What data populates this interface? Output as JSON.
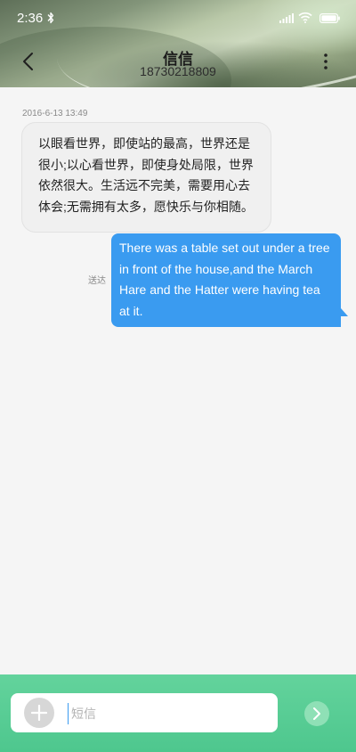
{
  "status_bar": {
    "time": "2:36",
    "icons": [
      "bluetooth-icon",
      "signal-icon",
      "wifi-icon",
      "battery-icon"
    ]
  },
  "header": {
    "contact_name": "信信",
    "contact_number": "18730218809",
    "back_icon": "chevron-left-icon",
    "more_icon": "more-vertical-icon"
  },
  "conversation": {
    "timestamp": "2016-6-13 13:49",
    "messages": [
      {
        "direction": "incoming",
        "text": "以眼看世界，即使站的最高，世界还是很小;以心看世界，即使身处局限，世界依然很大。生活远不完美，需要用心去体会;无需拥有太多，愿快乐与你相随。"
      },
      {
        "direction": "outgoing",
        "status": "送达",
        "text": "There was a table set out under a tree in front of the house,and the March Hare and the Hatter were having tea at it."
      }
    ]
  },
  "composer": {
    "placeholder": "短信",
    "value": "",
    "add_icon": "plus-icon",
    "send_icon": "send-arrow-icon"
  },
  "colors": {
    "outgoing_bubble": "#3a9bf0",
    "incoming_bubble": "#f0f0f0",
    "composer_bar": "#56cc94",
    "background": "#f5f5f5"
  }
}
